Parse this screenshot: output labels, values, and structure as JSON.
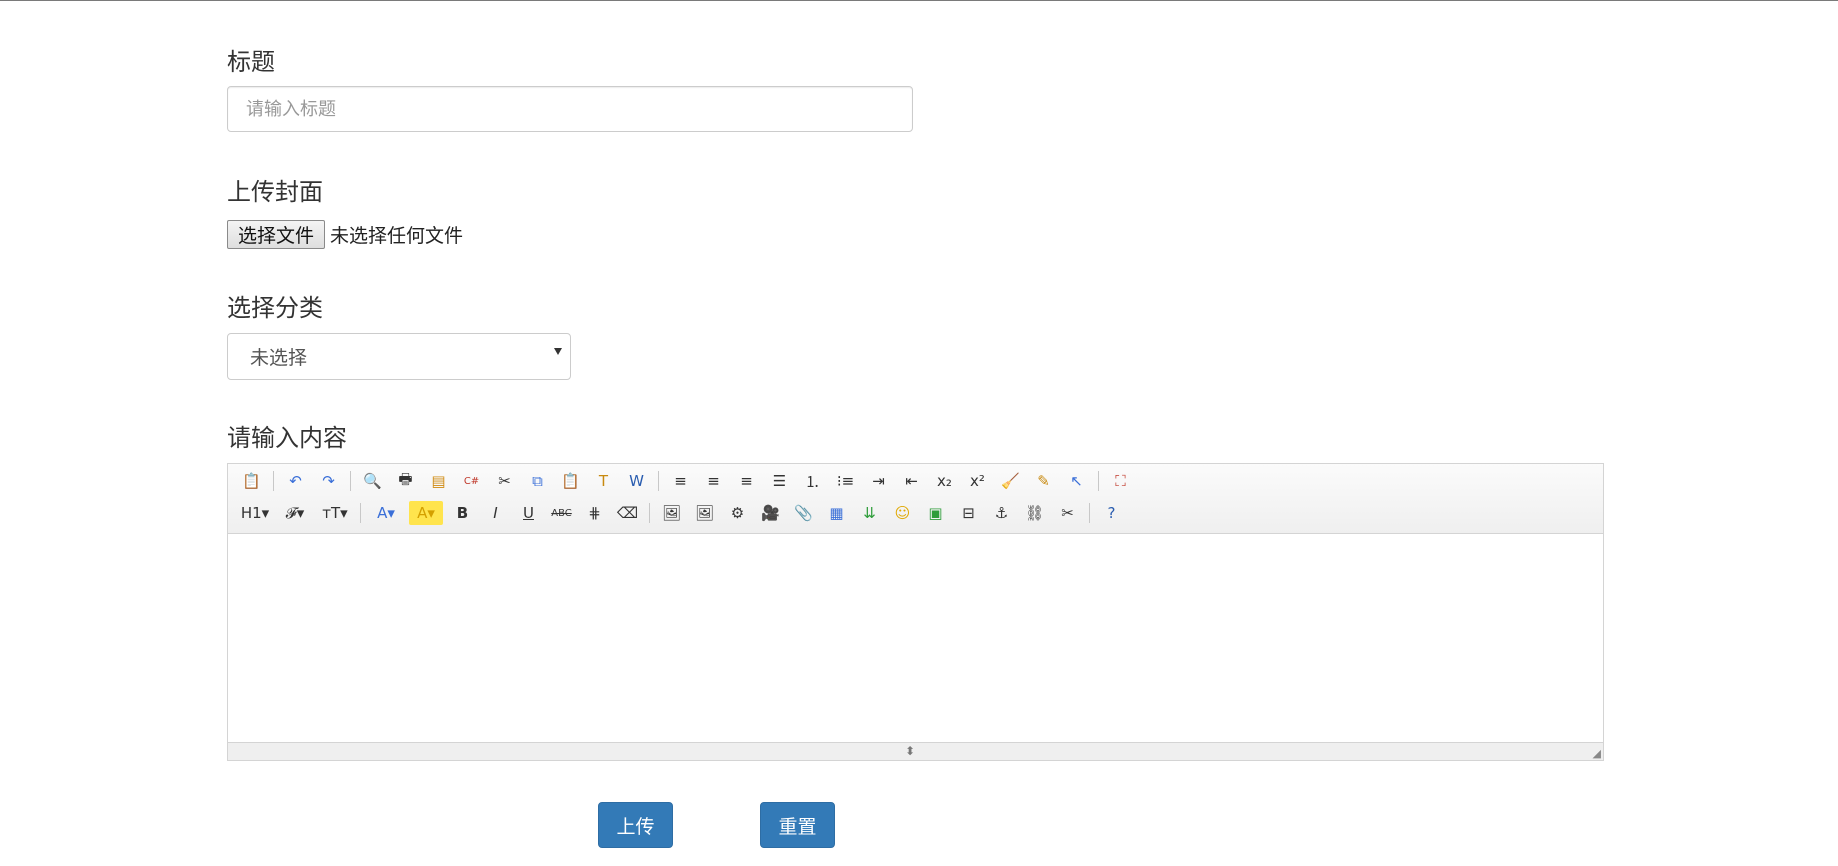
{
  "form": {
    "title_label": "标题",
    "title_placeholder": "请输入标题",
    "cover_label": "上传封面",
    "file_button": "选择文件",
    "file_status": "未选择任何文件",
    "category_label": "选择分类",
    "category_selected": "未选择",
    "content_label": "请输入内容"
  },
  "editor": {
    "row1": [
      {
        "name": "source-icon",
        "glyph": "📋"
      },
      {
        "sep": true
      },
      {
        "name": "undo-icon",
        "glyph": "↶",
        "color": "#3a6fd8"
      },
      {
        "name": "redo-icon",
        "glyph": "↷",
        "color": "#3a6fd8"
      },
      {
        "sep": true
      },
      {
        "name": "preview-icon",
        "glyph": "🔍"
      },
      {
        "name": "print-icon",
        "glyph": "🖶"
      },
      {
        "name": "template-icon",
        "glyph": "▤",
        "color": "#d08a10"
      },
      {
        "name": "code-icon",
        "glyph": "C#",
        "color": "#c0392b",
        "small": true
      },
      {
        "name": "cut-icon",
        "glyph": "✂"
      },
      {
        "name": "copy-icon",
        "glyph": "⧉",
        "color": "#3a6fd8"
      },
      {
        "name": "paste-icon",
        "glyph": "📋"
      },
      {
        "name": "paste-plain-icon",
        "glyph": "T",
        "color": "#c88a10"
      },
      {
        "name": "paste-word-icon",
        "glyph": "W",
        "color": "#2a5db0"
      },
      {
        "sep": true
      },
      {
        "name": "align-left-icon",
        "glyph": "≡"
      },
      {
        "name": "align-center-icon",
        "glyph": "≡"
      },
      {
        "name": "align-right-icon",
        "glyph": "≡"
      },
      {
        "name": "align-justify-icon",
        "glyph": "☰"
      },
      {
        "name": "ordered-list-icon",
        "glyph": "⒈"
      },
      {
        "name": "unordered-list-icon",
        "glyph": "⁝≡"
      },
      {
        "name": "indent-icon",
        "glyph": "⇥"
      },
      {
        "name": "outdent-icon",
        "glyph": "⇤"
      },
      {
        "name": "subscript-icon",
        "glyph": "x₂"
      },
      {
        "name": "superscript-icon",
        "glyph": "x²"
      },
      {
        "name": "clear-format-icon",
        "glyph": "🧹"
      },
      {
        "name": "select-all-icon",
        "glyph": "✎",
        "color": "#c88a10"
      },
      {
        "name": "pointer-icon",
        "glyph": "↖",
        "color": "#3a6fd8"
      },
      {
        "sep": true
      },
      {
        "name": "fullscreen-icon",
        "glyph": "⛶",
        "color": "#c0392b"
      }
    ],
    "row2": [
      {
        "name": "heading-dropdown",
        "glyph": "H1▾",
        "wide": true
      },
      {
        "name": "font-family-dropdown",
        "glyph": "𝓕▾",
        "wide": true
      },
      {
        "name": "font-size-dropdown",
        "glyph": "тT▾",
        "wide": true
      },
      {
        "sep": true
      },
      {
        "name": "font-color-dropdown",
        "glyph": "A▾",
        "color": "#3a6fd8",
        "wide": true
      },
      {
        "name": "highlight-color-dropdown",
        "glyph": "A▾",
        "color": "#d4a000",
        "wide": true
      },
      {
        "name": "bold-icon",
        "glyph": "B"
      },
      {
        "name": "italic-icon",
        "glyph": "I"
      },
      {
        "name": "underline-icon",
        "glyph": "U"
      },
      {
        "name": "strikethrough-icon",
        "glyph": "ABC",
        "small": true
      },
      {
        "name": "line-height-icon",
        "glyph": "⋕"
      },
      {
        "name": "eraser-icon",
        "glyph": "⌫"
      },
      {
        "sep": true
      },
      {
        "name": "insert-image-icon",
        "glyph": "🖼"
      },
      {
        "name": "multi-image-icon",
        "glyph": "🖼"
      },
      {
        "name": "flash-icon",
        "glyph": "⚙"
      },
      {
        "name": "video-icon",
        "glyph": "🎥"
      },
      {
        "name": "attachment-icon",
        "glyph": "📎"
      },
      {
        "name": "table-icon",
        "glyph": "▦",
        "color": "#3a6fd8"
      },
      {
        "name": "insert-row-icon",
        "glyph": "⇊",
        "color": "#2e9d3a"
      },
      {
        "name": "emoji-icon",
        "glyph": "☺",
        "color": "#e0a800"
      },
      {
        "name": "map-icon",
        "glyph": "▣",
        "color": "#2e9d3a"
      },
      {
        "name": "pagebreak-icon",
        "glyph": "⊟"
      },
      {
        "name": "anchor-icon",
        "glyph": "⚓"
      },
      {
        "name": "link-icon",
        "glyph": "⛓"
      },
      {
        "name": "unlink-icon",
        "glyph": "✂"
      },
      {
        "sep": true
      },
      {
        "name": "help-icon",
        "glyph": "?",
        "color": "#2a5db0"
      }
    ]
  },
  "actions": {
    "upload_label": "上传",
    "reset_label": "重置"
  }
}
